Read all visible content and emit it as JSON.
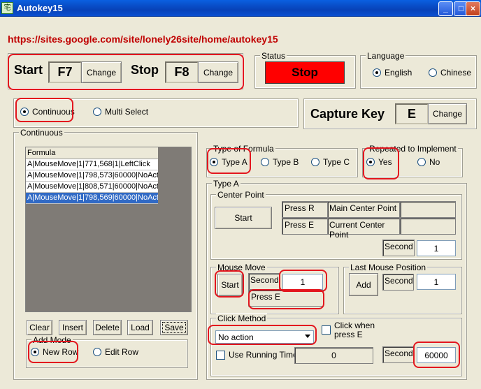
{
  "window": {
    "title": "Autokey15",
    "icon_char": "宅",
    "min": "_",
    "max": "□",
    "close": "×"
  },
  "url": "https://sites.google.com/site/lonely26site/home/autokey15",
  "hotkeys": {
    "start_label": "Start",
    "start_key": "F7",
    "start_change": "Change",
    "stop_label": "Stop",
    "stop_key": "F8",
    "stop_change": "Change"
  },
  "status": {
    "label": "Status",
    "value": "Stop",
    "color": "#ff0000"
  },
  "language": {
    "label": "Language",
    "english": "English",
    "chinese": "Chinese",
    "selected": "English"
  },
  "mode": {
    "continuous": "Continuous",
    "multi_select": "Multi Select",
    "selected": "Continuous"
  },
  "capture": {
    "label": "Capture Key",
    "key": "E",
    "change": "Change"
  },
  "continuous_group": {
    "label": "Continuous"
  },
  "formula_list": {
    "header": "Formula",
    "rows": [
      "A|MouseMove|1|771,568|1|LeftClick",
      "A|MouseMove|1|798,573|60000|NoAct",
      "A|MouseMove|1|808,571|60000|NoAct",
      "A|MouseMove|1|798,569|60000|NoAct"
    ],
    "selected_index": 3
  },
  "list_buttons": {
    "clear": "Clear",
    "insert": "Insert",
    "delete": "Delete",
    "load": "Load",
    "save": "Save"
  },
  "add_mode": {
    "label": "Add Mode",
    "new_row": "New Row",
    "edit_row": "Edit Row",
    "selected": "New Row"
  },
  "type_of_formula": {
    "label": "Type of Formula",
    "a": "Type A",
    "b": "Type B",
    "c": "Type C",
    "selected": "Type A"
  },
  "repeated": {
    "label": "Repeated to Implement",
    "yes": "Yes",
    "no": "No",
    "selected": "Yes"
  },
  "type_a": {
    "label": "Type A"
  },
  "center_point": {
    "label": "Center Point",
    "start": "Start",
    "press_r": "Press R",
    "main_center": "Main Center Point",
    "press_e": "Press E",
    "current_center": "Current Center Point",
    "second_label": "Second",
    "second_value": "1"
  },
  "mouse_move": {
    "label": "Mouse Move",
    "start": "Start",
    "second_label": "Second",
    "second_value": "1",
    "press_e": "Press E"
  },
  "last_mouse": {
    "label": "Last Mouse Position",
    "add": "Add",
    "second_label": "Second",
    "second_value": "1"
  },
  "click_method": {
    "label": "Click Method",
    "selected_option": "No action",
    "click_when": "Click when press E",
    "use_running": "Use Running Time",
    "running_value": "0",
    "second_label": "Second",
    "second_value": "60000"
  }
}
